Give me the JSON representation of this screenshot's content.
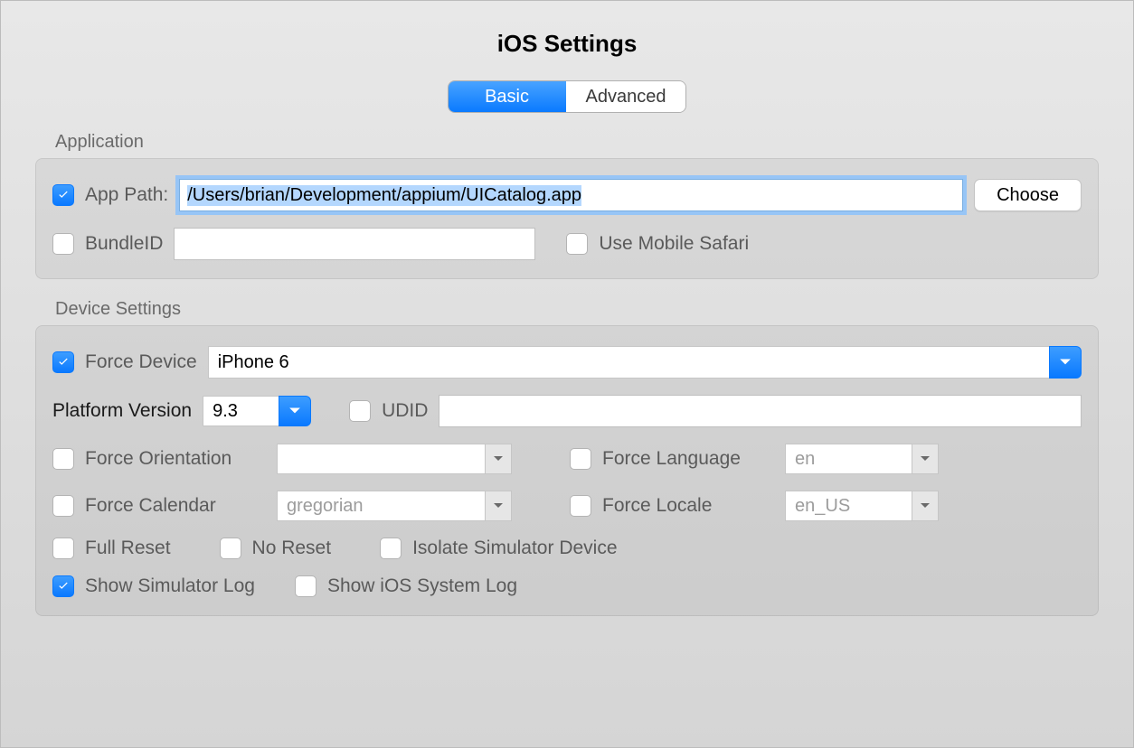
{
  "title": "iOS Settings",
  "tabs": {
    "basic": "Basic",
    "advanced": "Advanced",
    "active": "basic"
  },
  "application": {
    "section_label": "Application",
    "app_path": {
      "checked": true,
      "label": "App Path:",
      "value": "/Users/brian/Development/appium/UICatalog.app",
      "choose": "Choose"
    },
    "bundle_id": {
      "checked": false,
      "label": "BundleID",
      "value": ""
    },
    "mobile_safari": {
      "checked": false,
      "label": "Use Mobile Safari"
    }
  },
  "device": {
    "section_label": "Device Settings",
    "force_device": {
      "checked": true,
      "label": "Force Device",
      "value": "iPhone 6"
    },
    "platform_version": {
      "label": "Platform Version",
      "value": "9.3"
    },
    "udid": {
      "checked": false,
      "label": "UDID",
      "value": ""
    },
    "force_orientation": {
      "checked": false,
      "label": "Force Orientation",
      "value": ""
    },
    "force_language": {
      "checked": false,
      "label": "Force Language",
      "value": "en"
    },
    "force_calendar": {
      "checked": false,
      "label": "Force Calendar",
      "value": "gregorian"
    },
    "force_locale": {
      "checked": false,
      "label": "Force Locale",
      "value": "en_US"
    },
    "full_reset": {
      "checked": false,
      "label": "Full Reset"
    },
    "no_reset": {
      "checked": false,
      "label": "No Reset"
    },
    "isolate_sim": {
      "checked": false,
      "label": "Isolate Simulator Device"
    },
    "show_sim_log": {
      "checked": true,
      "label": "Show Simulator Log"
    },
    "show_sys_log": {
      "checked": false,
      "label": "Show iOS System Log"
    }
  }
}
